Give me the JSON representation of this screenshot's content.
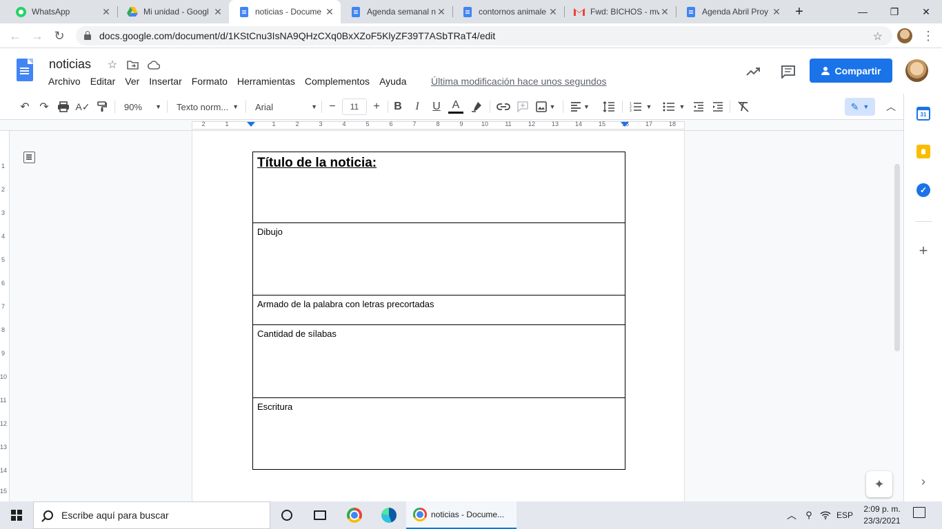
{
  "browser": {
    "tabs": [
      {
        "title": "WhatsApp",
        "favicon": "whatsapp-icon"
      },
      {
        "title": "Mi unidad - Googl",
        "favicon": "google-drive-icon"
      },
      {
        "title": "noticias - Docume",
        "favicon": "google-docs-icon",
        "active": true
      },
      {
        "title": "Agenda semanal n",
        "favicon": "google-docs-icon"
      },
      {
        "title": "contornos animale",
        "favicon": "google-docs-icon"
      },
      {
        "title": "Fwd: BICHOS - mv",
        "favicon": "gmail-icon"
      },
      {
        "title": "Agenda Abril Proy",
        "favicon": "google-docs-icon"
      }
    ],
    "close_glyph": "✕",
    "new_tab_glyph": "+",
    "window_controls": {
      "minimize": "—",
      "maximize": "❐",
      "close": "✕"
    },
    "url": "docs.google.com/document/d/1KStCnu3IsNA9QHzCXq0BxXZoF5KlyZF39T7ASbTRaT4/edit"
  },
  "docs": {
    "title": "noticias",
    "menu": [
      "Archivo",
      "Editar",
      "Ver",
      "Insertar",
      "Formato",
      "Herramientas",
      "Complementos",
      "Ayuda"
    ],
    "last_edit": "Última modificación hace unos segundos",
    "share_label": "Compartir",
    "accent": "#1a73e8"
  },
  "toolbar": {
    "zoom": "90%",
    "style": "Texto norm...",
    "font": "Arial",
    "font_size": "11",
    "bold": "B",
    "italic": "I",
    "underline": "U",
    "text_color": "A"
  },
  "ruler": {
    "numbers": [
      "2",
      "1",
      "1",
      "2",
      "3",
      "4",
      "5",
      "6",
      "7",
      "8",
      "9",
      "10",
      "11",
      "12",
      "13",
      "14",
      "15",
      "16",
      "17",
      "18"
    ],
    "vertical_numbers": [
      "1",
      "2",
      "3",
      "4",
      "5",
      "6",
      "7",
      "8",
      "9",
      "10",
      "11",
      "12",
      "13",
      "14",
      "15"
    ]
  },
  "document": {
    "table_rows": [
      "Título de la noticia:",
      "Dibujo",
      "Armado de la palabra con letras precortadas",
      "Cantidad de sílabas",
      "Escritura"
    ]
  },
  "side_panel": {
    "calendar_label": "31"
  },
  "taskbar": {
    "search_placeholder": "Escribe aquí para buscar",
    "active_window": "noticias - Docume...",
    "language": "ESP",
    "time": "2:09 p. m.",
    "date": "23/3/2021"
  }
}
